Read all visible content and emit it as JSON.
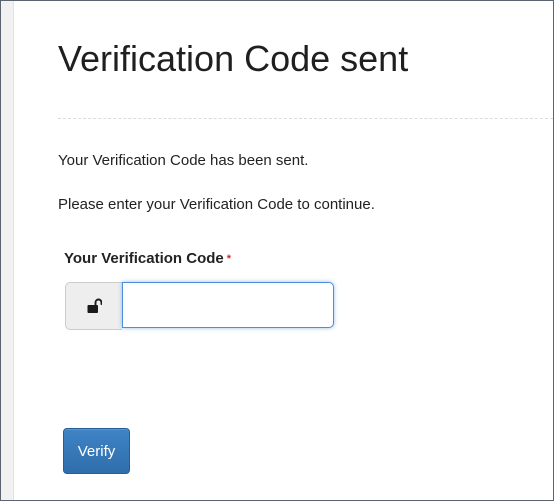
{
  "page": {
    "title": "Verification Code sent",
    "message_sent": "Your Verification Code has been sent.",
    "message_instruction": "Please enter your Verification Code to continue."
  },
  "form": {
    "code_label": "Your Verification Code",
    "required_marker": "*",
    "addon_icon": "unlocked-padlock-icon",
    "code_value": "",
    "code_placeholder": "",
    "submit_label": "Verify"
  },
  "colors": {
    "primary_button": "#337ab7",
    "required_marker": "#c9302c",
    "input_focus_border": "#4a8fd8",
    "addon_background": "#eeeeee"
  }
}
